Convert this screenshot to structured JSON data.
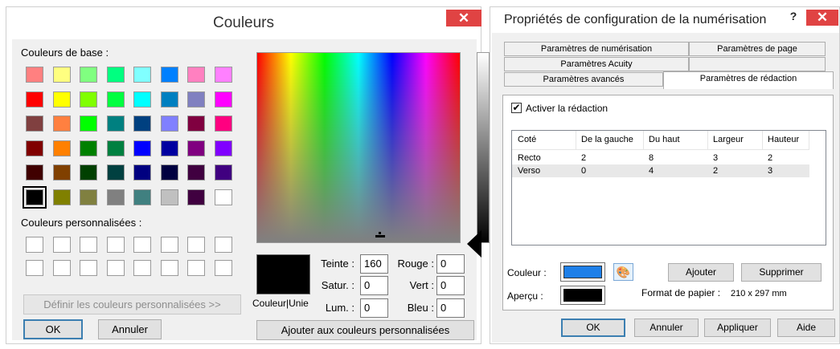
{
  "colors_dialog": {
    "title": "Couleurs",
    "basic_label": "Couleurs de base :",
    "basic_colors": [
      [
        "#ff8080",
        "#ffff80",
        "#80ff80",
        "#00ff80",
        "#80ffff",
        "#0080ff",
        "#ff80c0",
        "#ff80ff"
      ],
      [
        "#ff0000",
        "#ffff00",
        "#80ff00",
        "#00ff40",
        "#00ffff",
        "#0080c0",
        "#8080c0",
        "#ff00ff"
      ],
      [
        "#804040",
        "#ff8040",
        "#00ff00",
        "#008080",
        "#004080",
        "#8080ff",
        "#800040",
        "#ff0080"
      ],
      [
        "#800000",
        "#ff8000",
        "#008000",
        "#008040",
        "#0000ff",
        "#0000a0",
        "#800080",
        "#8000ff"
      ],
      [
        "#400000",
        "#804000",
        "#004000",
        "#004040",
        "#000080",
        "#000040",
        "#400040",
        "#400080"
      ],
      [
        "#000000",
        "#808000",
        "#808040",
        "#808080",
        "#408080",
        "#c0c0c0",
        "#400040",
        "#ffffff"
      ]
    ],
    "custom_label": "Couleurs personnalisées :",
    "define_button": "Définir les couleurs personnalisées >>",
    "ok_button": "OK",
    "cancel_button": "Annuler",
    "solid_label": "Couleur|Unie",
    "fields": {
      "teinte": {
        "label": "Teinte :",
        "value": "160"
      },
      "satur": {
        "label": "Satur. :",
        "value": "0"
      },
      "lum": {
        "label": "Lum. :",
        "value": "0"
      },
      "rouge": {
        "label": "Rouge :",
        "value": "0"
      },
      "vert": {
        "label": "Vert :",
        "value": "0"
      },
      "bleu": {
        "label": "Bleu :",
        "value": "0"
      }
    },
    "add_custom_button": "Ajouter aux couleurs personnalisées"
  },
  "scan_dialog": {
    "title": "Propriétés de configuration de la numérisation",
    "help_label": "?",
    "tabs_row1": [
      "Paramètres de numérisation",
      "Paramètres de page"
    ],
    "tabs_row2": [
      "Paramètres Acuity",
      ""
    ],
    "tabs_row3": [
      "Paramètres avancés",
      "Paramètres de rédaction"
    ],
    "activate_label": "Activer la rédaction",
    "activate_checked": true,
    "table": {
      "headers": [
        "Coté",
        "De la gauche",
        "Du haut",
        "Largeur",
        "Hauteur"
      ],
      "rows": [
        [
          "Recto",
          "2",
          "8",
          "3",
          "2"
        ],
        [
          "Verso",
          "0",
          "4",
          "2",
          "3"
        ]
      ]
    },
    "color_label": "Couleur :",
    "color_value": "#1e7fe8",
    "preview_label": "Aperçu :",
    "add_button": "Ajouter",
    "delete_button": "Supprimer",
    "paper_format_label": "Format de papier :",
    "paper_format_value": "210 x 297 mm",
    "buttons": {
      "ok": "OK",
      "cancel": "Annuler",
      "apply": "Appliquer",
      "help": "Aide"
    }
  }
}
